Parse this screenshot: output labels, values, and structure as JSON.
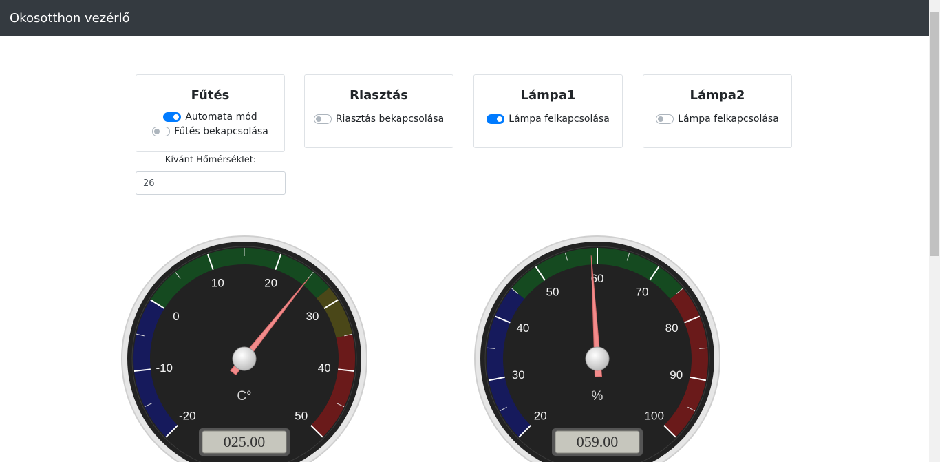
{
  "app": {
    "title": "Okosotthon vezérlő"
  },
  "cards": {
    "heating": {
      "title": "Fűtés",
      "auto_label": "Automata mód",
      "auto_on": true,
      "switch_label": "Fűtés bekapcsolása",
      "switch_on": false
    },
    "alarm": {
      "title": "Riasztás",
      "switch_label": "Riasztás bekapcsolása",
      "switch_on": false
    },
    "lamp1": {
      "title": "Lámpa1",
      "switch_label": "Lámpa felkapcsolása",
      "switch_on": true
    },
    "lamp2": {
      "title": "Lámpa2",
      "switch_label": "Lámpa felkapcsolása",
      "switch_on": false
    }
  },
  "desired_temp": {
    "label": "Kívánt Hőmérséklet:",
    "value": "26"
  },
  "gauges": {
    "temperature": {
      "min": -20,
      "max": 50,
      "value": 25,
      "ticks": [
        "-20",
        "-10",
        "0",
        "10",
        "20",
        "30",
        "40",
        "50"
      ],
      "unit": "C°",
      "readout": "025.00",
      "bands": [
        {
          "from": -20,
          "to": 0,
          "color": "#161a5c"
        },
        {
          "from": 0,
          "to": 28,
          "color": "#154a20"
        },
        {
          "from": 28,
          "to": 35,
          "color": "#4a4718"
        },
        {
          "from": 35,
          "to": 50,
          "color": "#6a1a1a"
        }
      ]
    },
    "humidity": {
      "min": 20,
      "max": 100,
      "value": 59,
      "ticks": [
        "20",
        "30",
        "40",
        "50",
        "60",
        "70",
        "80",
        "90",
        "100"
      ],
      "unit": "%",
      "readout": "059.00",
      "bands": [
        {
          "from": 20,
          "to": 45,
          "color": "#161a5c"
        },
        {
          "from": 45,
          "to": 75,
          "color": "#154a20"
        },
        {
          "from": 75,
          "to": 100,
          "color": "#6a1a1a"
        }
      ]
    }
  }
}
